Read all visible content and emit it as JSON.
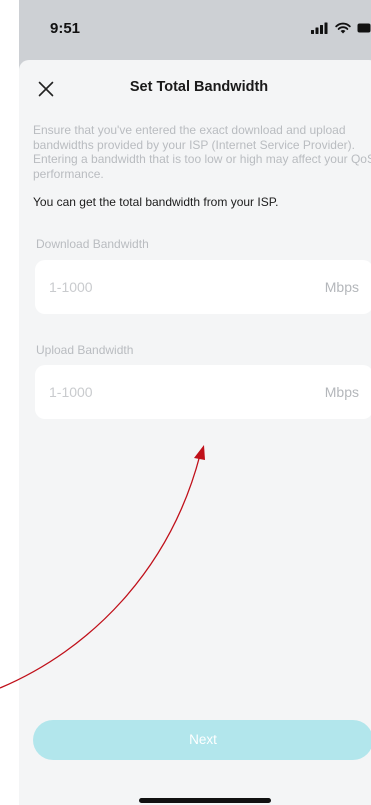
{
  "status_bar": {
    "time": "9:51",
    "icons": [
      "signal-icon",
      "wifi-icon",
      "battery-icon"
    ]
  },
  "sheet": {
    "title": "Set Total Bandwidth",
    "close_icon": "close-icon",
    "description": "Ensure that you've entered the exact download and upload bandwidths provided by your ISP (Internet Service Provider). Entering a bandwidth that is too low or high may affect your QoS performance.",
    "tip": "You can get the total bandwidth from your ISP.",
    "download": {
      "label": "Download Bandwidth",
      "placeholder": "1-1000",
      "value": "",
      "unit": "Mbps"
    },
    "upload": {
      "label": "Upload Bandwidth",
      "placeholder": "1-1000",
      "value": "",
      "unit": "Mbps"
    },
    "next_label": "Next"
  },
  "colors": {
    "accent_disabled": "#b2e6ec",
    "annotation_arrow": "#c0101a",
    "sheet_background": "#f4f5f6"
  }
}
